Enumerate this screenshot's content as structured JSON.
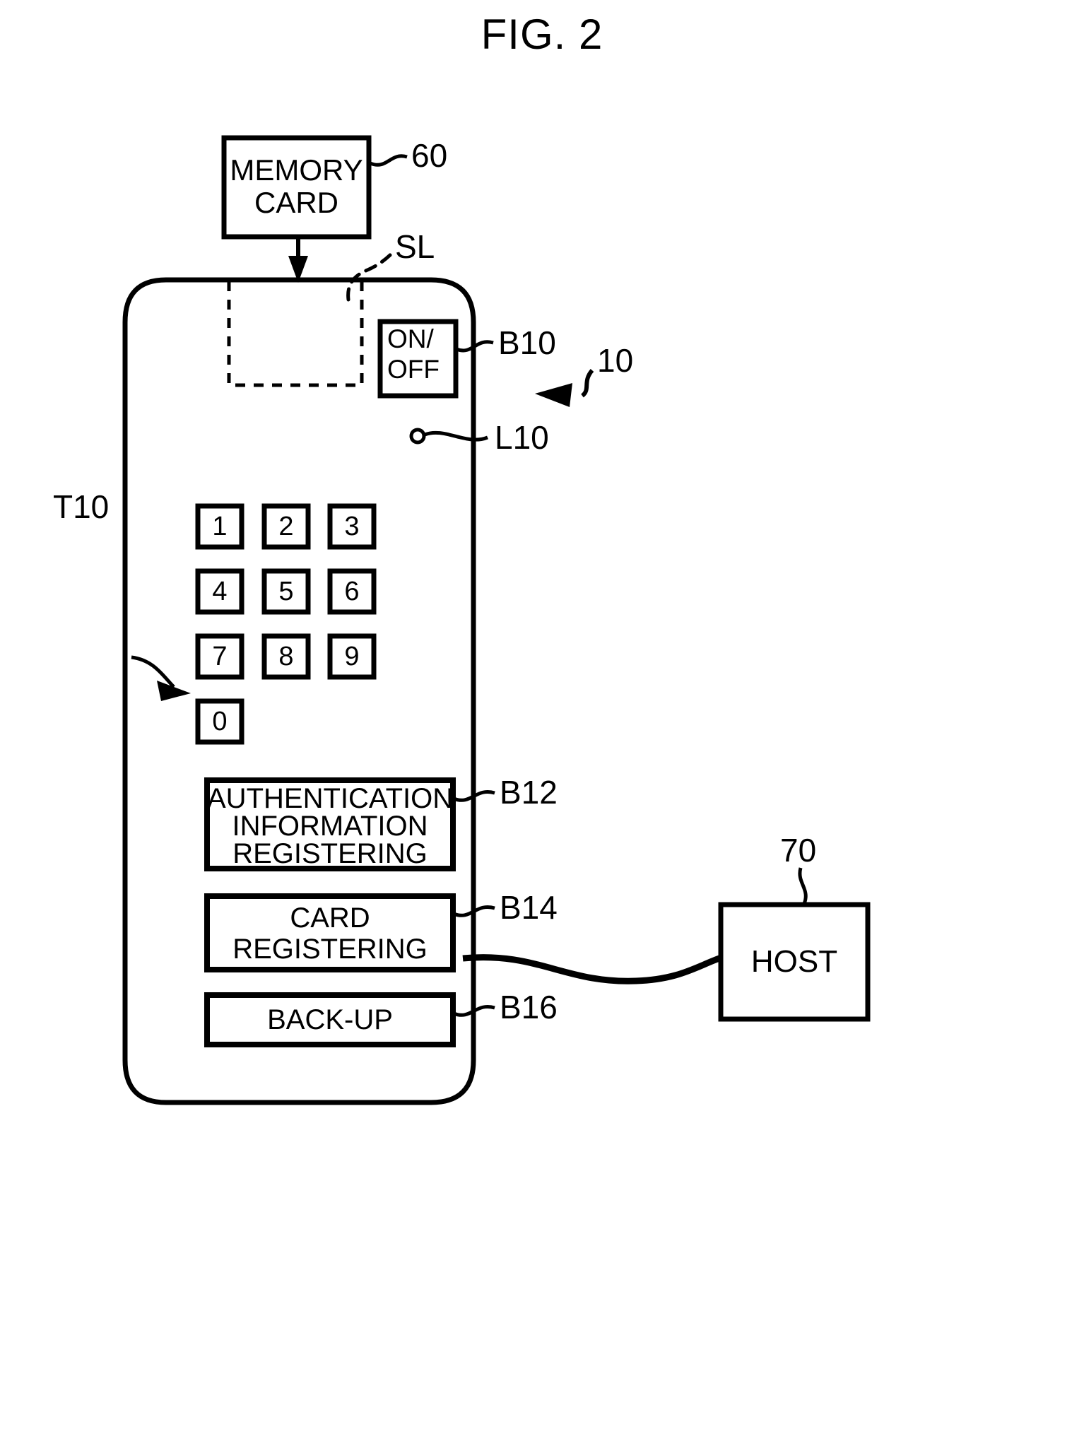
{
  "figure": {
    "title": "FIG. 2"
  },
  "memory_card": {
    "label_line1": "MEMORY",
    "label_line2": "CARD",
    "ref": "60"
  },
  "device": {
    "ref": "10",
    "slot_ref": "SL",
    "led_ref": "L10",
    "keypad_ref": "T10",
    "power_button": {
      "label_line1": "ON/",
      "label_line2": "OFF",
      "ref": "B10"
    },
    "keypad": {
      "keys": [
        "1",
        "2",
        "3",
        "4",
        "5",
        "6",
        "7",
        "8",
        "9",
        "0"
      ]
    },
    "buttons": [
      {
        "lines": [
          "AUTHENTICATION",
          "INFORMATION",
          "REGISTERING"
        ],
        "ref": "B12"
      },
      {
        "lines": [
          "CARD",
          "REGISTERING"
        ],
        "ref": "B14"
      },
      {
        "lines": [
          "BACK-UP"
        ],
        "ref": "B16"
      }
    ]
  },
  "host": {
    "label": "HOST",
    "ref": "70"
  }
}
